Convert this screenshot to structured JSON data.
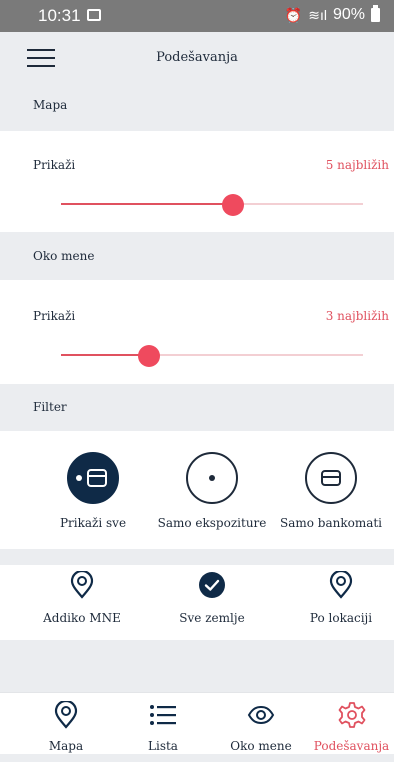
{
  "status_bar": {
    "time": "10:31",
    "battery": "90%"
  },
  "header": {
    "title": "Podešavanja"
  },
  "map_section": {
    "title": "Mapa",
    "show_label": "Prikaži",
    "show_value": "5 najbližih",
    "slider_value": 0.57
  },
  "nearby_section": {
    "title": "Oko mene",
    "show_label": "Prikaži",
    "show_value": "3 najbližih",
    "slider_value": 0.29
  },
  "filter_section": {
    "title": "Filter",
    "options": [
      {
        "label": "Prikaži sve",
        "icon": "atm-card-icon",
        "active": true
      },
      {
        "label": "Samo ekspoziture",
        "icon": "dot-icon",
        "active": false
      },
      {
        "label": "Samo bankomati",
        "icon": "card-icon",
        "active": false
      }
    ]
  },
  "country_options": [
    {
      "label": "Addiko MNE",
      "icon": "location-pin-icon",
      "active": false
    },
    {
      "label": "Sve zemlje",
      "icon": "checkmark-icon",
      "active": true
    },
    {
      "label": "Po lokaciji",
      "icon": "location-pin-icon",
      "active": false
    }
  ],
  "bottom_nav": [
    {
      "label": "Mapa",
      "icon": "location-pin-icon",
      "active": false
    },
    {
      "label": "Lista",
      "icon": "list-icon",
      "active": false
    },
    {
      "label": "Oko mene",
      "icon": "eye-icon",
      "active": false
    },
    {
      "label": "Podešavanja",
      "icon": "gear-icon",
      "active": true
    }
  ],
  "colors": {
    "accent": "#e0515f",
    "navy": "#0f2a47",
    "section_bg": "#ebedf0",
    "text": "#1e2a3a"
  }
}
